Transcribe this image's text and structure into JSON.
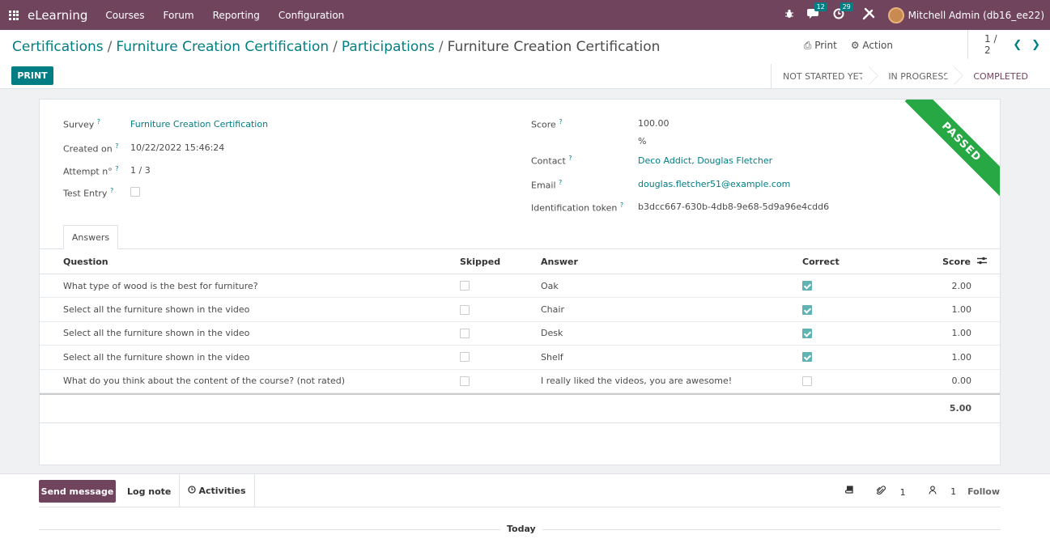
{
  "navbar": {
    "brand": "eLearning",
    "menu": [
      "Courses",
      "Forum",
      "Reporting",
      "Configuration"
    ],
    "icons": [
      "bug-icon",
      "chat-icon",
      "clock-icon",
      "tools-icon"
    ],
    "messages_count": "12",
    "activities_count": "29",
    "user": "Mitchell Admin (db16_ee22)"
  },
  "breadcrumb": {
    "items": [
      "Certifications",
      "Furniture Creation Certification",
      "Participations"
    ],
    "current": "Furniture Creation Certification"
  },
  "actions": {
    "print": "Print",
    "action": "Action"
  },
  "pager": {
    "value": "1 / 2"
  },
  "print_button": "PRINT",
  "statusbar": {
    "stages": [
      "NOT STARTED YET",
      "IN PROGRESS",
      "COMPLETED"
    ],
    "current": "COMPLETED"
  },
  "form": {
    "survey_label": "Survey",
    "survey_value": "Furniture Creation Certification",
    "created_label": "Created on",
    "created_value": "10/22/2022 15:46:24",
    "attempt_label": "Attempt n°",
    "attempt_value": "1 / 3",
    "test_label": "Test Entry",
    "test_checked": false,
    "score_label": "Score",
    "score_value": "100.00",
    "score_unit": "%",
    "contact_label": "Contact",
    "contact_value": "Deco Addict, Douglas Fletcher",
    "email_label": "Email",
    "email_value": "douglas.fletcher51@example.com",
    "token_label": "Identification token",
    "token_value": "b3dcc667-630b-4db8-9e68-5d9a96e4cdd6",
    "ribbon": "PASSED",
    "help_mark": "?"
  },
  "tabs": {
    "answers": "Answers"
  },
  "table": {
    "headers": {
      "question": "Question",
      "skipped": "Skipped",
      "answer": "Answer",
      "correct": "Correct",
      "score": "Score"
    },
    "rows": [
      {
        "question": "What type of wood is the best for furniture?",
        "skipped": false,
        "answer": "Oak",
        "correct": true,
        "score": "2.00"
      },
      {
        "question": "Select all the furniture shown in the video",
        "skipped": false,
        "answer": "Chair",
        "correct": true,
        "score": "1.00"
      },
      {
        "question": "Select all the furniture shown in the video",
        "skipped": false,
        "answer": "Desk",
        "correct": true,
        "score": "1.00"
      },
      {
        "question": "Select all the furniture shown in the video",
        "skipped": false,
        "answer": "Shelf",
        "correct": true,
        "score": "1.00"
      },
      {
        "question": "What do you think about the content of the course? (not rated)",
        "skipped": false,
        "answer": "I really liked the videos, you are awesome!",
        "correct": false,
        "score": "0.00"
      }
    ],
    "total": "5.00"
  },
  "chatter": {
    "send_message": "Send message",
    "log_note": "Log note",
    "activities": "Activities",
    "attachments_count": "1",
    "followers_count": "1",
    "follow": "Follow",
    "today": "Today"
  }
}
